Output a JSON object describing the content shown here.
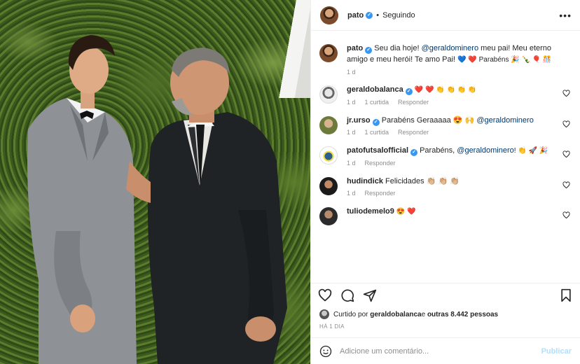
{
  "header": {
    "username": "pato",
    "separator": "•",
    "follow_status": "Seguindo",
    "more": "•••"
  },
  "caption": {
    "username": "pato",
    "text_1": "Seu dia hoje! ",
    "mention": "@geraldominero",
    "text_2": " meu pai! Meu eterno amigo e meu herói! Te amo Pai! ",
    "emoji_tail": "💙 ❤️  Parabéns 🎉 🍾 🎈 🎊",
    "time": "1 d"
  },
  "comments": [
    {
      "username": "geraldobalanca",
      "text": "❤️ ❤️ 👏 👏 👏 👏",
      "time": "1 d",
      "likes": "1 curtida",
      "reply": "Responder"
    },
    {
      "username": "jr.urso",
      "text": "Parabéns Geraaaaa 😍 🙌 ",
      "mention": "@geraldominero",
      "time": "1 d",
      "likes": "1 curtida",
      "reply": "Responder"
    },
    {
      "username": "patofutsalofficial",
      "text": "Parabéns, ",
      "mention": "@geraldominero",
      "text_after": "! 👏 🚀 🎉",
      "time": "1 d",
      "reply": "Responder"
    },
    {
      "username": "hudindick",
      "text": "Felicidades 👏🏼 👏🏼 👏🏼",
      "time": "1 d",
      "reply": "Responder"
    },
    {
      "username": "tuliodemelo9",
      "text": "😍 ❤️"
    }
  ],
  "liked_by": {
    "prefix": "Curtido por ",
    "user": "geraldobalanca",
    "middle": " e ",
    "others": "outras 8.442 pessoas"
  },
  "posted_ago": "HÁ 1 DIA",
  "comment_box": {
    "placeholder": "Adicione um comentário...",
    "publish": "Publicar"
  },
  "colors": {
    "verified": "#3897f0",
    "mention": "#00376b",
    "secondary_text": "#8e8e8e",
    "publish_disabled": "#b2dffc"
  }
}
